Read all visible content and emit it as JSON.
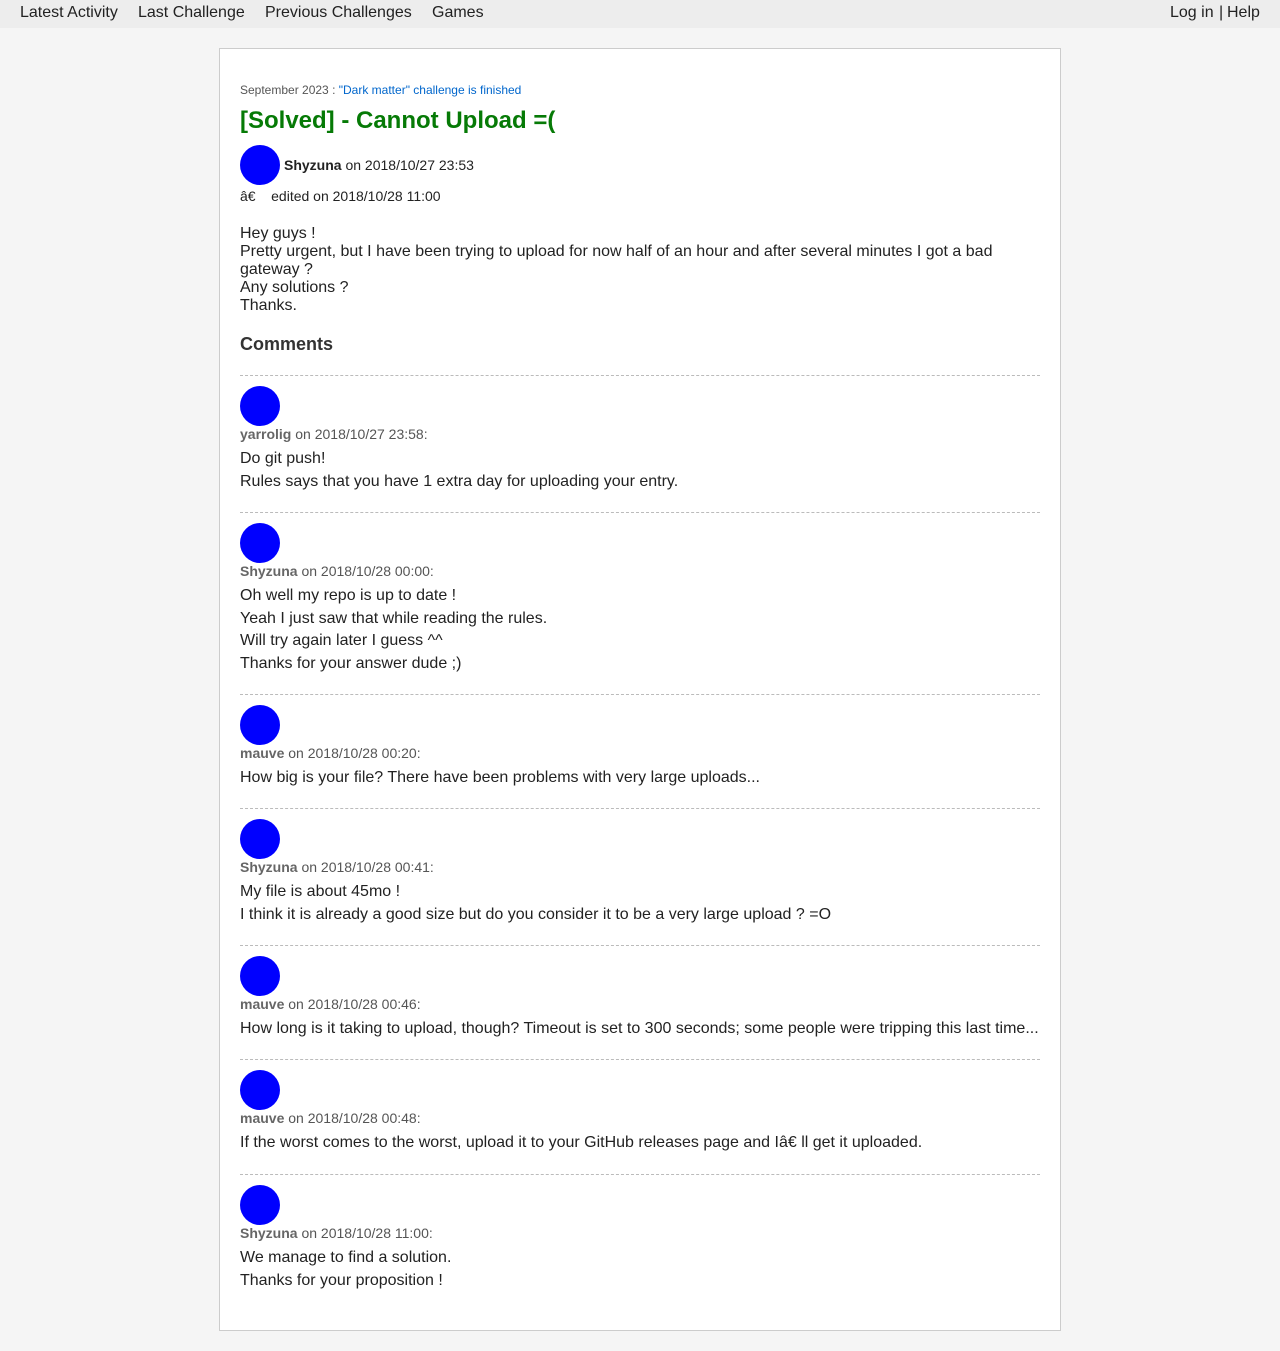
{
  "nav": {
    "latest_activity": "Latest Activity",
    "last_challenge": "Last Challenge",
    "previous_challenges": "Previous Challenges",
    "games": "Games",
    "log_in": "Log in",
    "separator": "|",
    "help": "Help"
  },
  "announcement": {
    "date": "September 2023 :",
    "link": "\"Dark matter\" challenge is finished"
  },
  "post": {
    "title": "[Solved] - Cannot Upload =(",
    "author": "Shyzuna",
    "date_text": "on 2018/10/27 23:53",
    "edited_prefix": "â€",
    "edited_text": "edited on 2018/10/28 11:00",
    "body": [
      "Hey guys !",
      "Pretty urgent, but I have been trying to upload for now half of an hour and after several minutes I got a bad gateway ?",
      "Any solutions ?",
      "Thanks."
    ]
  },
  "comments_heading": "Comments",
  "comments": [
    {
      "author": "yarrolig",
      "date_text": "on 2018/10/27 23:58:",
      "lines": [
        "Do git push!",
        "Rules says that you have 1 extra day for uploading your entry."
      ]
    },
    {
      "author": "Shyzuna",
      "date_text": "on 2018/10/28 00:00:",
      "lines": [
        "Oh well my repo is up to date !",
        "Yeah I just saw that while reading the rules.",
        "Will try again later I guess ^^",
        "Thanks for your answer dude ;)"
      ]
    },
    {
      "author": "mauve",
      "date_text": "on 2018/10/28 00:20:",
      "lines": [
        "How big is your file? There have been problems with very large uploads..."
      ]
    },
    {
      "author": "Shyzuna",
      "date_text": "on 2018/10/28 00:41:",
      "lines": [
        "My file is about 45mo !",
        "I think it is already a good size but do you consider it to be a very large upload ? =O"
      ]
    },
    {
      "author": "mauve",
      "date_text": "on 2018/10/28 00:46:",
      "lines": [
        "How long is it taking to upload, though? Timeout is set to 300 seconds; some people were tripping this last time..."
      ]
    },
    {
      "author": "mauve",
      "date_text": "on 2018/10/28 00:48:",
      "lines": [
        "If the worst comes to the worst, upload it to your GitHub releases page and Iâ€   ll get it uploaded."
      ]
    },
    {
      "author": "Shyzuna",
      "date_text": "on 2018/10/28 11:00:",
      "lines": [
        "We manage to find a solution.",
        "Thanks for your proposition !"
      ]
    }
  ]
}
